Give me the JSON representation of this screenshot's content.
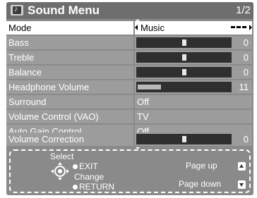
{
  "title": "Sound Menu",
  "page": "1/2",
  "rows": {
    "mode": {
      "label": "Mode",
      "value": "Music"
    },
    "bass": {
      "label": "Bass",
      "value": "0",
      "level": 0.5
    },
    "treble": {
      "label": "Treble",
      "value": "0",
      "level": 0.5
    },
    "balance": {
      "label": "Balance",
      "value": "0",
      "level": 0.5
    },
    "headphone_volume": {
      "label": "Headphone Volume",
      "value": "11",
      "level": 0.25
    },
    "surround": {
      "label": "Surround",
      "value": "Off"
    },
    "volume_control": {
      "label": "Volume Control (VAO)",
      "value": "TV"
    },
    "auto_gain": {
      "label": "Auto Gain Control",
      "value": "Off"
    },
    "volume_correction": {
      "label": "Volume Correction",
      "value": "0",
      "level": 0.5
    }
  },
  "help": {
    "select": "Select",
    "exit": "EXIT",
    "change": "Change",
    "return": "RETURN",
    "page_up": "Page up",
    "page_down": "Page down"
  },
  "icons": {
    "title": "sound-note-icon",
    "dpad": "dpad-icon",
    "page_up": "page-up-icon",
    "page_down": "page-down-icon"
  }
}
